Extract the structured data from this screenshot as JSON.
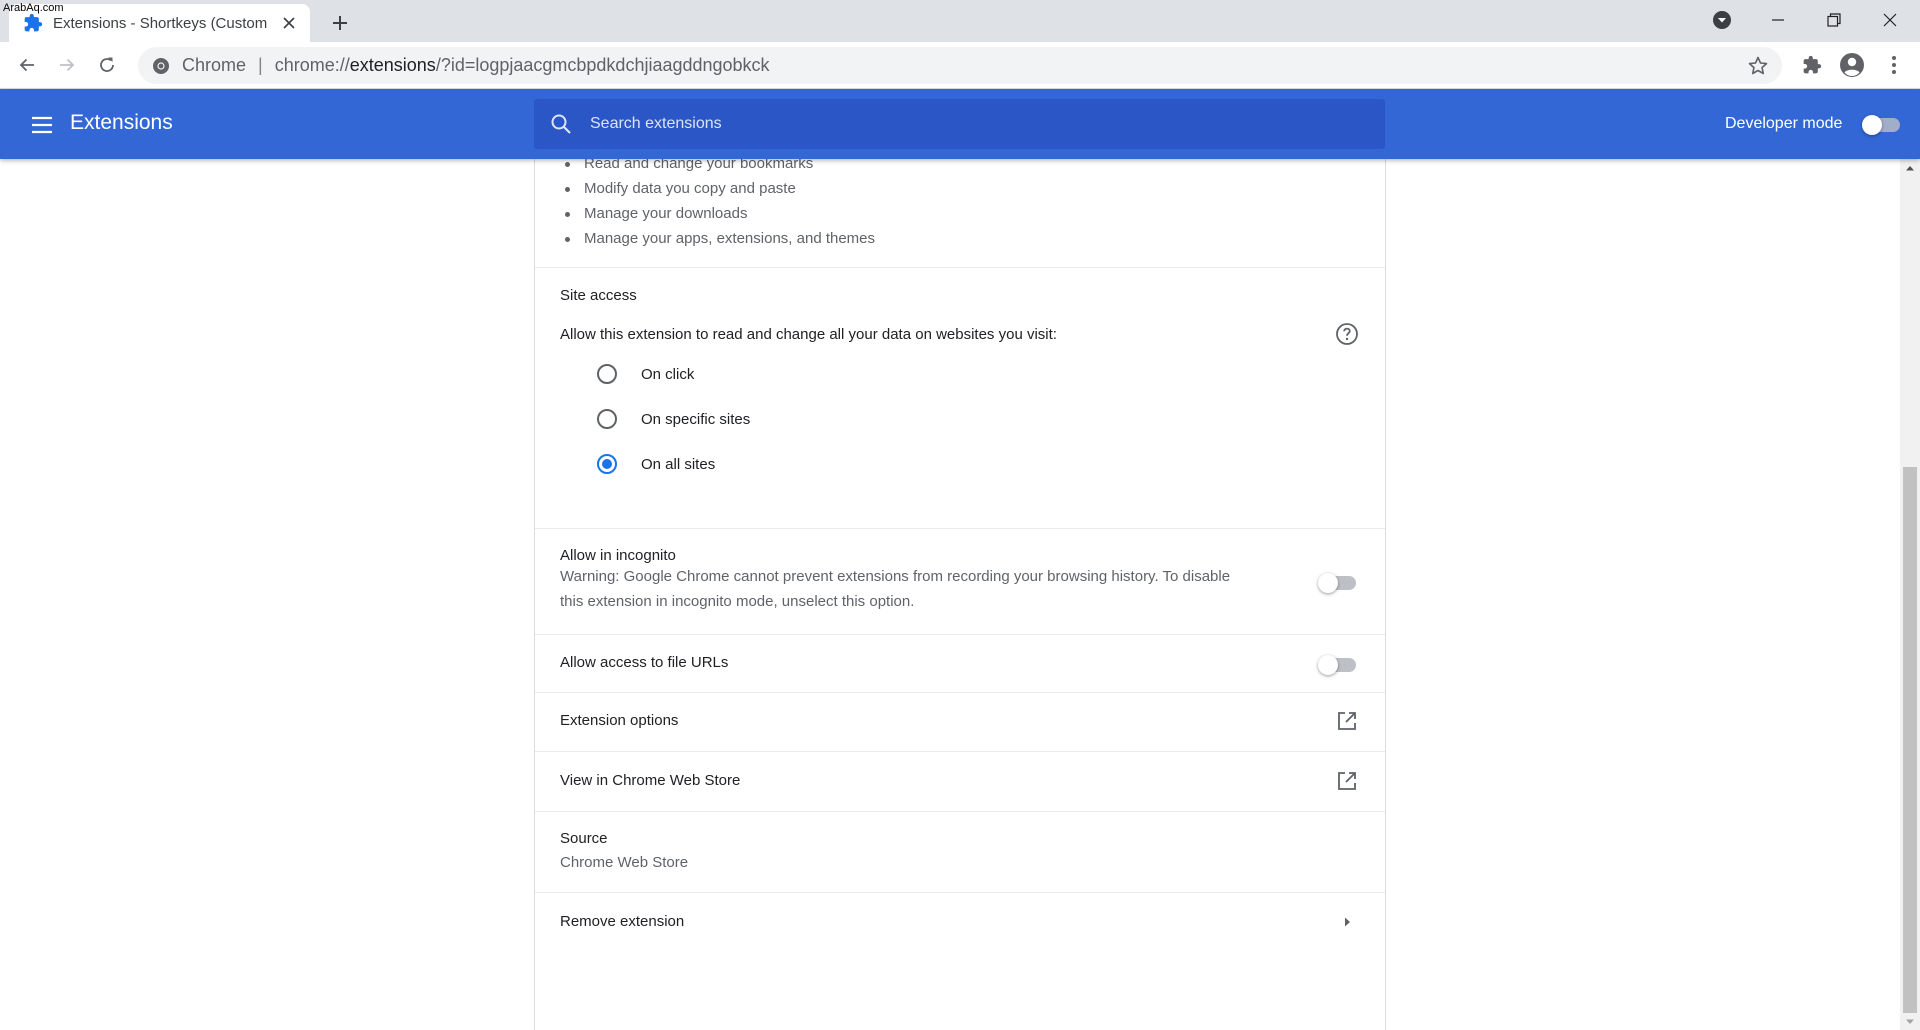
{
  "watermark": "ArabAq.com",
  "tab": {
    "title": "Extensions - Shortkeys (Custom k",
    "favicon": "puzzle-icon"
  },
  "omnibox": {
    "origin": "Chrome",
    "url_prefix": "chrome://",
    "url_host": "extensions",
    "url_rest": "/?id=logpjaacgmcbpdkdchjiaagddngobkck"
  },
  "header": {
    "title": "Extensions",
    "search_placeholder": "Search extensions",
    "developer_mode_label": "Developer mode",
    "developer_mode_on": false
  },
  "permissions": [
    "Read and change your bookmarks",
    "Modify data you copy and paste",
    "Manage your downloads",
    "Manage your apps, extensions, and themes"
  ],
  "site_access": {
    "heading": "Site access",
    "description": "Allow this extension to read and change all your data on websites you visit:",
    "options": [
      {
        "label": "On click",
        "checked": false
      },
      {
        "label": "On specific sites",
        "checked": false
      },
      {
        "label": "On all sites",
        "checked": true
      }
    ]
  },
  "incognito": {
    "title": "Allow in incognito",
    "warning_line1": "Warning: Google Chrome cannot prevent extensions from recording your browsing history. To disable",
    "warning_line2": "this extension in incognito mode, unselect this option.",
    "enabled": false
  },
  "file_urls": {
    "title": "Allow access to file URLs",
    "enabled": false
  },
  "extension_options": {
    "label": "Extension options"
  },
  "web_store": {
    "label": "View in Chrome Web Store"
  },
  "source": {
    "title": "Source",
    "value": "Chrome Web Store"
  },
  "remove": {
    "label": "Remove extension"
  },
  "colors": {
    "header_blue": "#3367d6",
    "search_blue": "#2a56c6",
    "accent": "#1a73e8"
  }
}
